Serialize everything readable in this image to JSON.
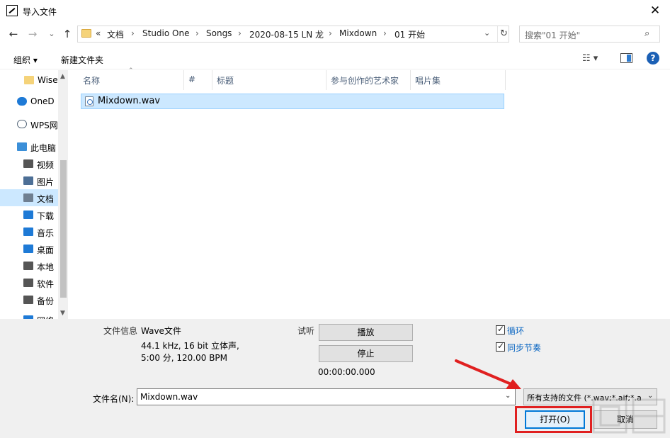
{
  "window": {
    "title": "导入文件",
    "close_glyph": "✕"
  },
  "nav": {
    "back_glyph": "←",
    "forward_glyph": "→",
    "recent_glyph": "⌄",
    "up_glyph": "↑"
  },
  "address": {
    "lead": "«",
    "crumbs": [
      "文档",
      "Studio One",
      "Songs",
      "2020-08-15 LN 龙",
      "Mixdown",
      "01 开始"
    ],
    "separator": "›",
    "dropdown_glyph": "⌄",
    "refresh_glyph": "↻"
  },
  "search": {
    "placeholder": "搜索\"01 开始\"",
    "icon": "⌕"
  },
  "toolbar": {
    "organize": "组织 ▾",
    "new_folder": "新建文件夹",
    "view_glyph": "☷ ▾",
    "help": "?"
  },
  "sidebar": {
    "items": [
      {
        "label": "Wise",
        "icon": "folder-icon",
        "color": "#f5d37a"
      },
      {
        "label": "OneD",
        "icon": "cloud-icon",
        "color": "#1e7ad6"
      },
      {
        "label": "WPS网",
        "icon": "cloud-outline-icon",
        "color": "#5a6b7d"
      },
      {
        "label": "此电脑",
        "icon": "computer-icon",
        "color": "#3b8fd8"
      },
      {
        "label": "视频",
        "icon": "video-icon",
        "color": "#555555"
      },
      {
        "label": "图片",
        "icon": "picture-icon",
        "color": "#4d6f96"
      },
      {
        "label": "文档",
        "icon": "document-icon",
        "color": "#6f7f91"
      },
      {
        "label": "下载",
        "icon": "download-icon",
        "color": "#1e7ad6"
      },
      {
        "label": "音乐",
        "icon": "music-icon",
        "color": "#1e7ad6"
      },
      {
        "label": "桌面",
        "icon": "desktop-icon",
        "color": "#1e7ad6"
      },
      {
        "label": "本地",
        "icon": "drive-icon",
        "color": "#555555"
      },
      {
        "label": "软件",
        "icon": "drive-icon",
        "color": "#555555"
      },
      {
        "label": "备份",
        "icon": "drive-icon",
        "color": "#555555"
      },
      {
        "label": "网络",
        "icon": "network-icon",
        "color": "#1e7ad6"
      }
    ],
    "selected_index": 6,
    "scroll_up": "▲",
    "scroll_down": "▼"
  },
  "columns": [
    "名称",
    "#",
    "标题",
    "参与创作的艺术家",
    "唱片集"
  ],
  "sort_glyph": "⌃",
  "files": [
    {
      "name": "Mixdown.wav",
      "selected": true
    }
  ],
  "info": {
    "file_info_label": "文件信息",
    "file_type": "Wave文件",
    "format": "44.1 kHz, 16 bit 立体声,",
    "duration": "5:00 分, 120.00 BPM",
    "audition_label": "试听",
    "play_btn": "播放",
    "stop_btn": "停止",
    "time": "00:00:00.000",
    "loop_label": "循环",
    "loop_checked": true,
    "sync_label": "同步节奏",
    "sync_checked": true
  },
  "footer": {
    "filename_label": "文件名(N):",
    "filename_value": "Mixdown.wav",
    "filter": "所有支持的文件 (*.wav;*.aif;*.a",
    "dropdown_glyph": "⌄",
    "open_btn": "打开(O)",
    "cancel_btn": "取消"
  },
  "colors": {
    "accent": "#0078d7",
    "selection": "#cce8ff",
    "annotation": "#e02020"
  }
}
